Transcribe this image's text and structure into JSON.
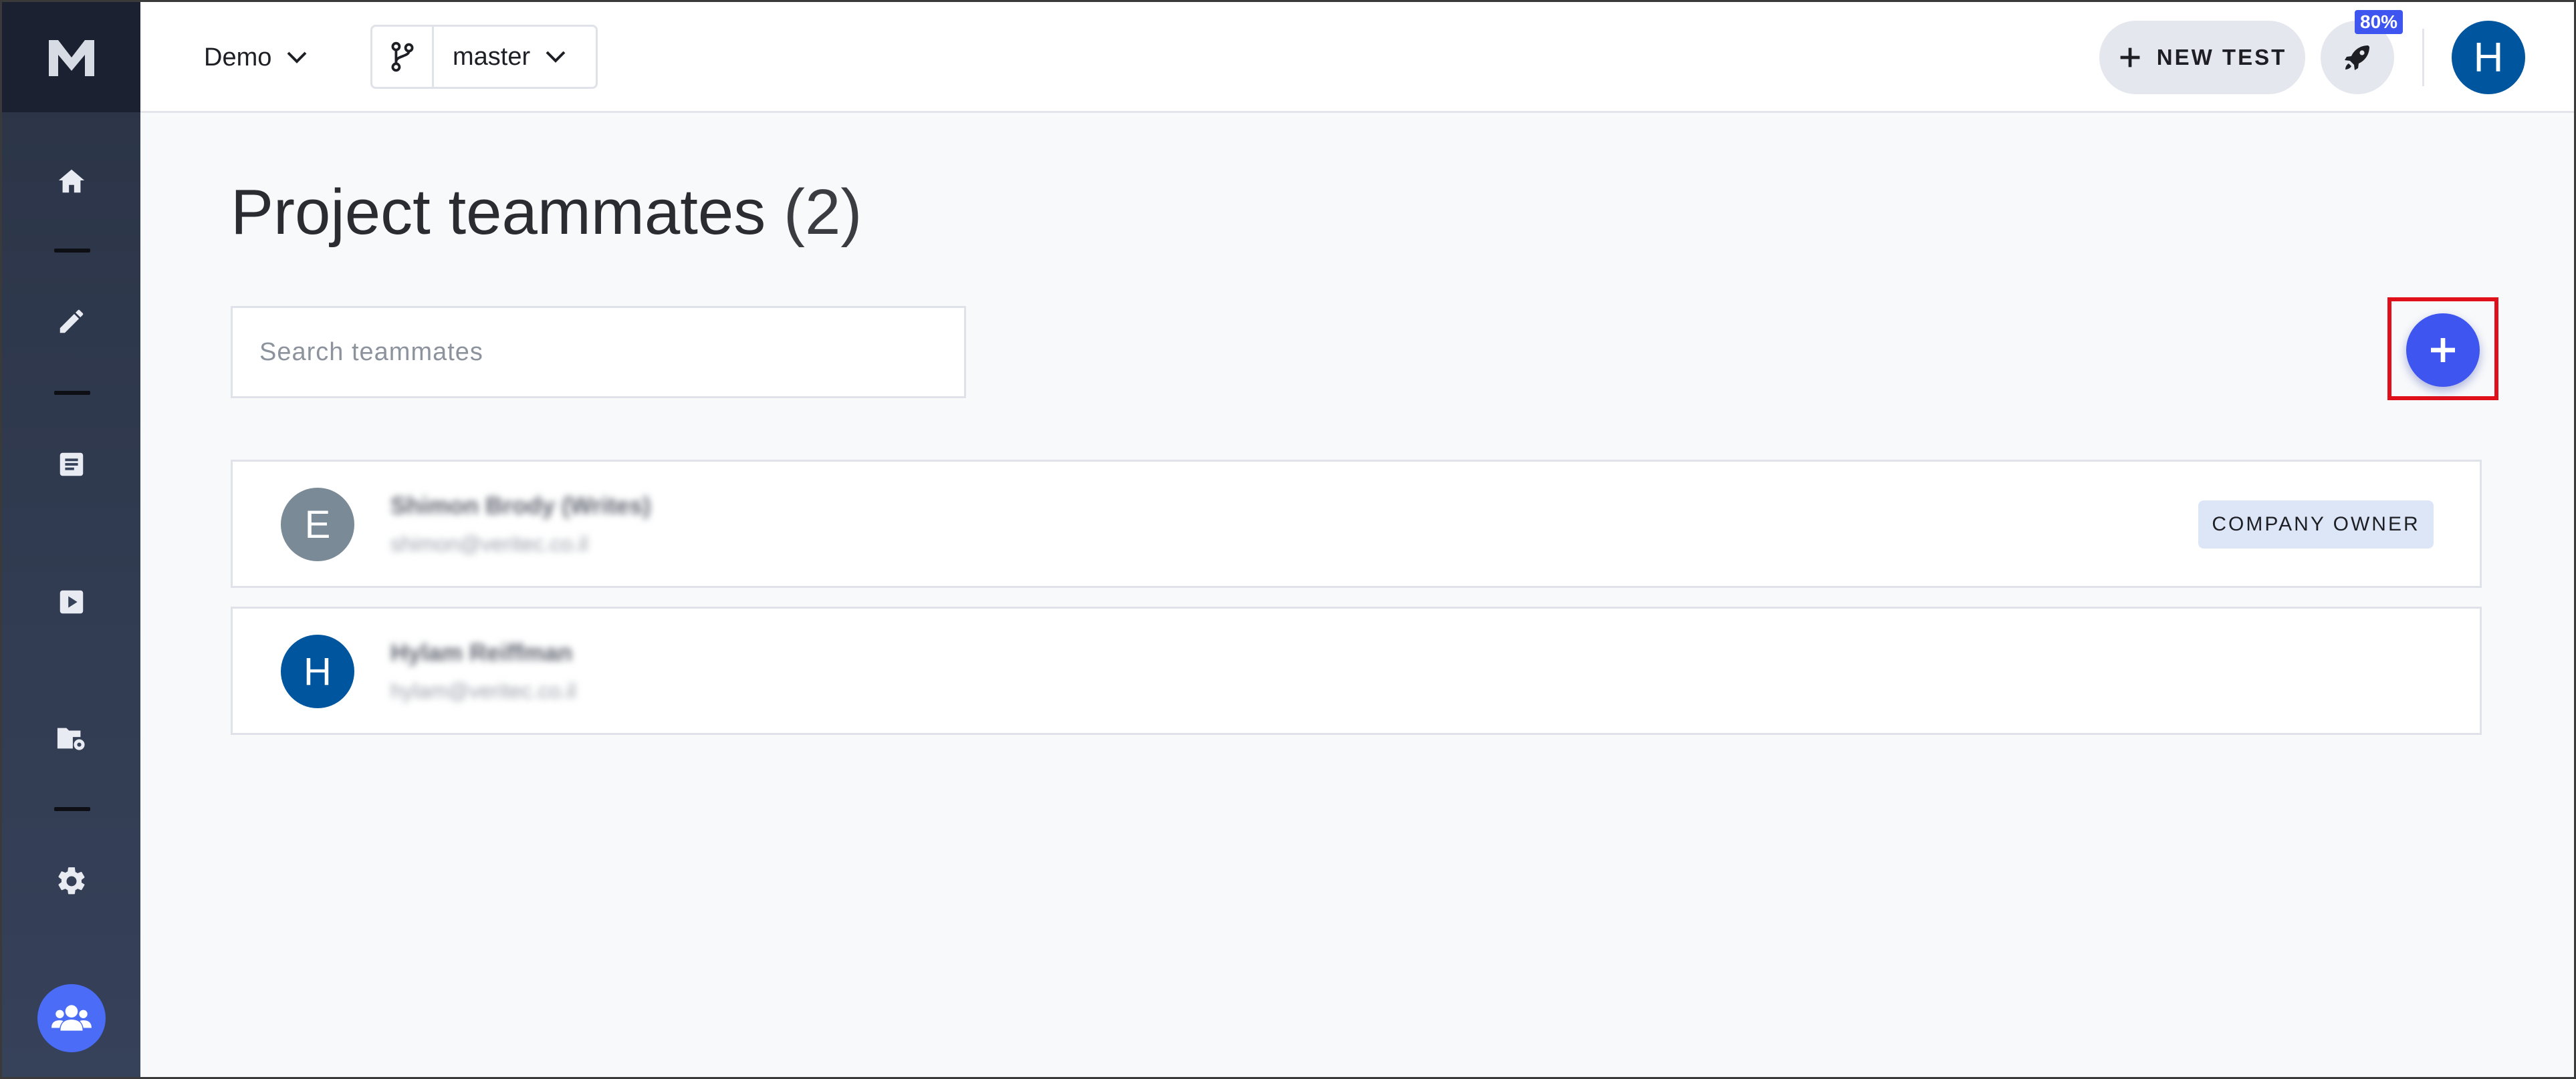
{
  "topbar": {
    "project_label": "Demo",
    "branch_label": "master",
    "new_test_label": "NEW TEST",
    "rocket_badge": "80%",
    "user_initial": "H"
  },
  "main": {
    "title": "Project teammates",
    "count": "(2)",
    "search_placeholder": "Search teammates"
  },
  "members": [
    {
      "initial": "E",
      "name": "Shimon Brody (Writes)",
      "email": "shimon@veritec.co.il",
      "role": "COMPANY OWNER",
      "avatar_color": "#7a8a96"
    },
    {
      "initial": "H",
      "name": "Hylam Reiffman",
      "email": "hylam@veritec.co.il",
      "role": "",
      "avatar_color": "#00569e"
    }
  ],
  "colors": {
    "accent": "#3e55f0",
    "highlight": "#e0101a"
  }
}
